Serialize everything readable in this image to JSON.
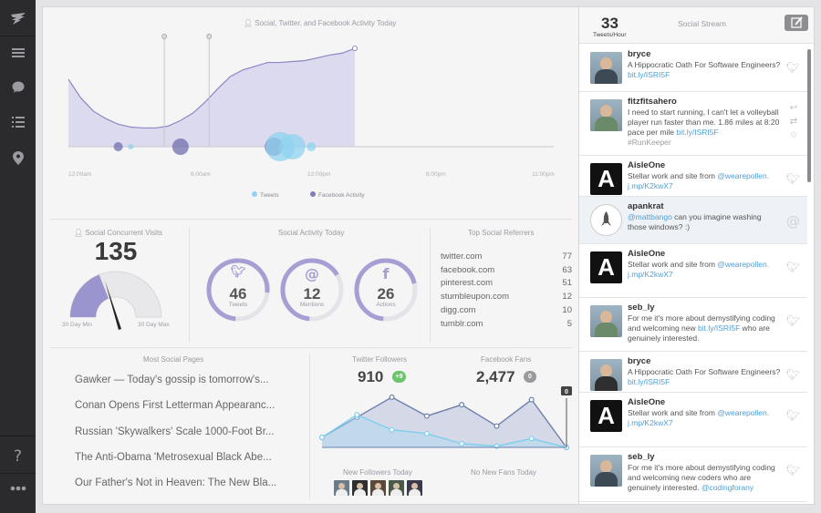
{
  "sidebar": {
    "items": [
      {
        "icon": "feather-logo-icon"
      },
      {
        "icon": "menu-lines-icon"
      },
      {
        "icon": "chat-bubble-icon"
      },
      {
        "icon": "list-icon"
      },
      {
        "icon": "location-pin-icon"
      },
      {
        "icon": "help-question-icon"
      },
      {
        "icon": "more-dots-icon"
      }
    ]
  },
  "activity": {
    "title": "Social, Twitter, and Facebook Activity Today",
    "x_ticks": [
      "12:00am",
      "6:00am",
      "12:00pm",
      "6:00pm",
      "11:00pm"
    ],
    "legend": [
      {
        "label": "Tweets",
        "color": "#8fd3ef"
      },
      {
        "label": "Facebook Activity",
        "color": "#7f7fb6"
      }
    ]
  },
  "chart_data": [
    {
      "type": "area",
      "title": "Social, Twitter, and Facebook Activity Today",
      "x": [
        0,
        1,
        2,
        3,
        4,
        5,
        6,
        7,
        8,
        9,
        10,
        11,
        12,
        13,
        14,
        15,
        16,
        17,
        18,
        19,
        20,
        21,
        22,
        23
      ],
      "x_ticks": [
        "12:00am",
        "6:00am",
        "12:00pm",
        "6:00pm",
        "11:00pm"
      ],
      "series": [
        {
          "name": "Facebook Activity",
          "values": [
            72,
            52,
            38,
            30,
            24,
            21,
            20,
            20,
            22,
            28,
            36,
            48,
            62,
            75,
            82,
            86,
            90,
            90,
            91,
            92,
            95,
            98,
            100,
            105
          ]
        }
      ],
      "bubbles": [
        {
          "x": 4.0,
          "size": 5,
          "series": "Facebook Activity"
        },
        {
          "x": 5.0,
          "size": 3,
          "series": "Tweets"
        },
        {
          "x": 9.0,
          "size": 9,
          "series": "Facebook Activity"
        },
        {
          "x": 16.5,
          "size": 10,
          "series": "Facebook Activity"
        },
        {
          "x": 17.0,
          "size": 16,
          "series": "Tweets"
        },
        {
          "x": 18.0,
          "size": 14,
          "series": "Tweets"
        },
        {
          "x": 19.5,
          "size": 5,
          "series": "Tweets"
        }
      ],
      "ylim": [
        0,
        110
      ],
      "legend": [
        "Tweets",
        "Facebook Activity"
      ],
      "grid": false
    },
    {
      "type": "line",
      "title": "Twitter Followers / Facebook Fans",
      "x": [
        0,
        1,
        2,
        3,
        4,
        5,
        6,
        7
      ],
      "series": [
        {
          "name": "Twitter Followers",
          "values": [
            8,
            24,
            40,
            25,
            34,
            17,
            38,
            0
          ]
        },
        {
          "name": "Facebook Fans",
          "values": [
            8,
            26,
            14,
            11,
            3,
            1,
            7,
            0
          ]
        }
      ],
      "ylim": [
        0,
        45
      ],
      "annotations": [
        "0"
      ]
    }
  ],
  "concurrent": {
    "title": "Social Concurrent Visits",
    "value": "135",
    "gauge_fraction": 0.38,
    "min_label": "30 Day Min",
    "max_label": "30 Day Max"
  },
  "social_activity": {
    "title": "Social Activity Today",
    "rings": [
      {
        "value": "46",
        "label": "Tweets",
        "icon": "twitter-bird-icon",
        "fill": 0.75
      },
      {
        "value": "12",
        "label": "Mentions",
        "icon": "at-icon",
        "fill": 0.65
      },
      {
        "value": "26",
        "label": "Actions",
        "icon": "facebook-f-icon",
        "fill": 0.7
      }
    ]
  },
  "referrers": {
    "title": "Top Social Referrers",
    "rows": [
      {
        "name": "twitter.com",
        "value": "77"
      },
      {
        "name": "facebook.com",
        "value": "63"
      },
      {
        "name": "pinterest.com",
        "value": "51"
      },
      {
        "name": "stumbleupon.com",
        "value": "12"
      },
      {
        "name": "digg.com",
        "value": "10"
      },
      {
        "name": "tumblr.com",
        "value": "5"
      }
    ]
  },
  "most_social": {
    "title": "Most Social Pages",
    "pages": [
      "Gawker — Today's gossip is tomorrow's...",
      "Conan Opens First Letterman Appearanc...",
      "Russian 'Skywalkers' Scale 1000-Foot Br...",
      "The Anti-Obama 'Metrosexual Black Abe...",
      "Our Father's Not in Heaven: The New Bla..."
    ]
  },
  "followers": {
    "twitter_label": "Twitter Followers",
    "twitter_value": "910",
    "twitter_delta": "+9",
    "facebook_label": "Facebook Fans",
    "facebook_value": "2,477",
    "facebook_delta": "0",
    "marker_label": "0",
    "new_followers_label": "New Followers Today",
    "no_new_fans_label": "No New Fans Today"
  },
  "stream": {
    "tweets_per_hour": "33",
    "tweets_per_hour_label": "Tweets/Hour",
    "title": "Social Stream",
    "tweets": [
      {
        "name": "bryce",
        "text": "A Hippocratic Oath For Software Engineers?",
        "link": "bit.ly/ISRI5F",
        "tail": "",
        "tag": "",
        "avatar": "photo",
        "action": "twitter-bird-icon",
        "hl": false
      },
      {
        "name": "fitzfitsahero",
        "text": "I need to start running, I can't let a volleyball player run faster than me. 1.86 miles at 8:20 pace per mile",
        "link": "bit.ly/ISRI5F",
        "tail": "",
        "tag": "#RunKeeper",
        "avatar": "photo",
        "action": "reply-retweet-star-icons",
        "hl": false
      },
      {
        "name": "AisleOne",
        "text": "Stellar work and site from",
        "link": "@wearepollen.",
        "tail": "",
        "link2": "j.mp/K2kwX7",
        "tag": "",
        "avatar": "A",
        "action": "twitter-bird-icon",
        "hl": false
      },
      {
        "name": "apankrat",
        "text": "",
        "pre_link": "@mattbango",
        "after": " can you imagine washing those windows? :)",
        "avatar": "rocket",
        "action": "at-icon",
        "hl": true
      },
      {
        "name": "AisleOne",
        "text": "Stellar work and site from",
        "link": "@wearepollen.",
        "link2": "j.mp/K2kwX7",
        "avatar": "A",
        "action": "twitter-bird-icon",
        "hl": false
      },
      {
        "name": "seb_ly",
        "text": "For me it's more about demystifying coding and welcoming new",
        "link": "bit.ly/ISRI5F",
        "after": " who are genuinely interested.",
        "avatar": "photo",
        "action": "twitter-bird-icon",
        "hl": false
      },
      {
        "name": "bryce",
        "text": "A Hippocratic Oath For Software Engineers?",
        "link": "bit.ly/ISRI5F",
        "avatar": "photo",
        "action": "twitter-bird-icon",
        "hl": false
      },
      {
        "name": "AisleOne",
        "text": "Stellar work and site from",
        "link": "@wearepollen.",
        "link2": "j.mp/K2kwX7",
        "avatar": "A",
        "action": "twitter-bird-icon",
        "hl": false
      },
      {
        "name": "seb_ly",
        "text": "For me it's more about demystifying coding and welcoming new coders who are genuinely interested.",
        "link": "@codingforany",
        "avatar": "photo",
        "action": "twitter-bird-icon",
        "hl": false
      }
    ]
  }
}
